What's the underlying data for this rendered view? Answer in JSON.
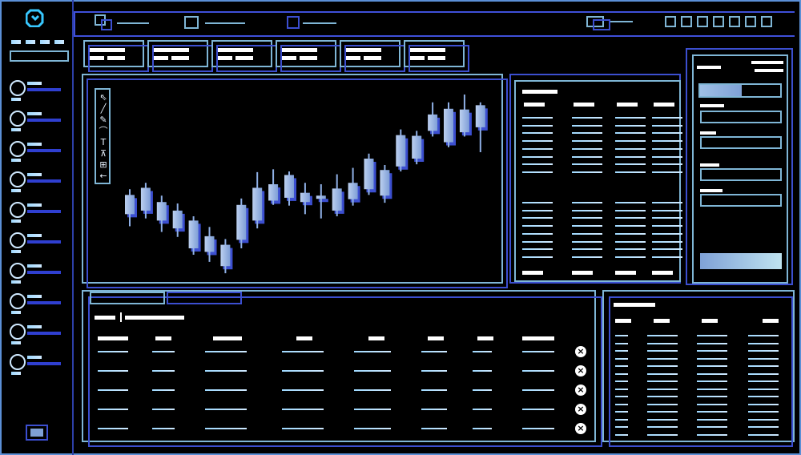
{
  "app": {
    "logo_icon": "logo-icon",
    "colors": {
      "accent": "#3c4fd0",
      "cyan": "#7fb6d6",
      "highlight": "#cfe9ff"
    }
  },
  "sidebar": {
    "items": [
      {
        "icon": "circle-icon"
      },
      {
        "icon": "circle-icon"
      },
      {
        "icon": "circle-icon"
      },
      {
        "icon": "circle-icon"
      },
      {
        "icon": "circle-icon"
      },
      {
        "icon": "circle-icon"
      },
      {
        "icon": "circle-icon"
      },
      {
        "icon": "circle-icon"
      },
      {
        "icon": "circle-icon"
      },
      {
        "icon": "circle-icon"
      }
    ],
    "bottom_icon": "square-icon"
  },
  "topbar": {
    "left_items": [
      "",
      ""
    ],
    "right_icons": [
      "square-icon",
      "square-icon",
      "square-icon",
      "square-icon",
      "square-icon",
      "square-icon",
      "square-icon"
    ]
  },
  "tiles": [
    {
      "label": ""
    },
    {
      "label": ""
    },
    {
      "label": ""
    },
    {
      "label": ""
    },
    {
      "label": ""
    },
    {
      "label": ""
    }
  ],
  "chart": {
    "tools": [
      "cursor-icon",
      "line-icon",
      "pencil-icon",
      "brush-icon",
      "text-icon",
      "measure-icon",
      "grid-icon",
      "back-icon"
    ]
  },
  "chart_data": {
    "type": "candlestick",
    "candles": [
      {
        "open": 1.0,
        "close": 0.73,
        "high": 1.08,
        "low": 0.56
      },
      {
        "open": 0.78,
        "close": 1.1,
        "high": 1.17,
        "low": 0.67
      },
      {
        "open": 0.9,
        "close": 0.64,
        "high": 0.99,
        "low": 0.48
      },
      {
        "open": 0.78,
        "close": 0.53,
        "high": 0.88,
        "low": 0.41
      },
      {
        "open": 0.64,
        "close": 0.25,
        "high": 0.7,
        "low": 0.16
      },
      {
        "open": 0.42,
        "close": 0.2,
        "high": 0.55,
        "low": 0.06
      },
      {
        "open": 0.3,
        "close": 0.0,
        "high": 0.38,
        "low": -0.1
      },
      {
        "open": 0.37,
        "close": 0.86,
        "high": 0.95,
        "low": 0.25
      },
      {
        "open": 0.64,
        "close": 1.1,
        "high": 1.32,
        "low": 0.53
      },
      {
        "open": 1.15,
        "close": 0.92,
        "high": 1.36,
        "low": 0.86
      },
      {
        "open": 0.96,
        "close": 1.28,
        "high": 1.33,
        "low": 0.85
      },
      {
        "open": 1.03,
        "close": 0.9,
        "high": 1.17,
        "low": 0.73
      },
      {
        "open": 0.99,
        "close": 0.98,
        "high": 1.15,
        "low": 0.67
      },
      {
        "open": 0.78,
        "close": 1.09,
        "high": 1.29,
        "low": 0.7
      },
      {
        "open": 0.94,
        "close": 1.17,
        "high": 1.38,
        "low": 0.85
      },
      {
        "open": 1.08,
        "close": 1.51,
        "high": 1.58,
        "low": 1.0
      },
      {
        "open": 0.99,
        "close": 1.35,
        "high": 1.42,
        "low": 0.89
      },
      {
        "open": 1.4,
        "close": 1.84,
        "high": 1.92,
        "low": 1.33
      },
      {
        "open": 1.51,
        "close": 1.83,
        "high": 1.9,
        "low": 1.43
      },
      {
        "open": 1.9,
        "close": 2.13,
        "high": 2.3,
        "low": 1.82
      },
      {
        "open": 1.74,
        "close": 2.21,
        "high": 2.3,
        "low": 1.67
      },
      {
        "open": 1.88,
        "close": 2.2,
        "high": 2.41,
        "low": 1.82
      },
      {
        "open": 1.95,
        "close": 2.26,
        "high": 2.3,
        "low": 1.6
      }
    ]
  },
  "orderbook": {
    "headers": [
      "",
      "",
      "",
      ""
    ]
  },
  "form": {
    "fields": [
      "",
      "",
      "",
      "",
      ""
    ],
    "submit_label": ""
  },
  "positions": {
    "tabs": [
      "",
      ""
    ],
    "headers": [
      "",
      "",
      "",
      "",
      "",
      "",
      "",
      ""
    ],
    "rows": 5
  },
  "trades": {
    "headers": [
      "",
      "",
      "",
      ""
    ],
    "rows": 14
  }
}
